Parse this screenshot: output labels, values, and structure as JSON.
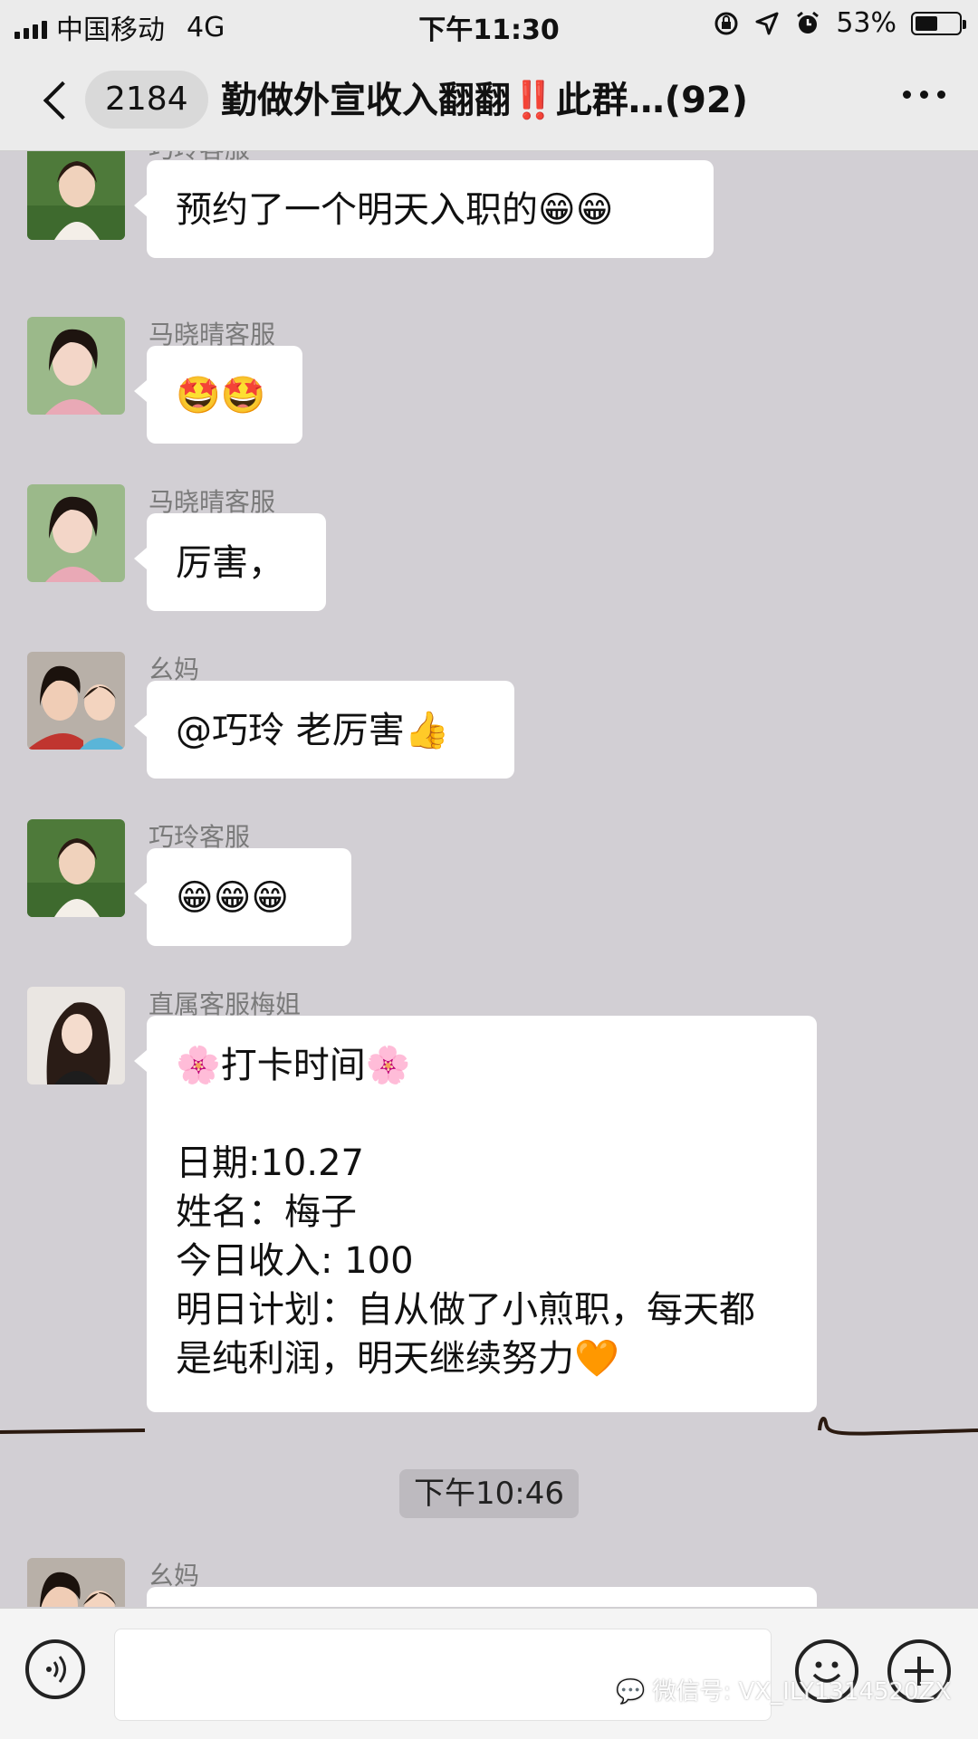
{
  "status_bar": {
    "carrier": "中国移动",
    "network": "4G",
    "time": "下午11:30",
    "battery": "53%",
    "battery_level": 0.53
  },
  "nav": {
    "unread_count": "2184",
    "title": "勤做外宣收入翻翻‼️此群…(92)"
  },
  "messages": [
    {
      "sender": "巧玲客服",
      "text": "预约了一个明天入职的😁😁"
    },
    {
      "sender": "马晓晴客服",
      "text": "🤩🤩"
    },
    {
      "sender": "马晓晴客服",
      "text": "厉害，"
    },
    {
      "sender": "幺妈",
      "text": "@巧玲 老厉害👍"
    },
    {
      "sender": "巧玲客服",
      "text": "😁😁😁"
    },
    {
      "sender": "直属客服梅姐",
      "text": "🌸打卡时间🌸\n\n日期:10.27\n姓名：梅子\n今日收入: 100\n明日计划：自从做了小煎职，每天都是纯利润，明天继续努力🧡"
    },
    {
      "sender": "幺妈",
      "text": ""
    }
  ],
  "time_divider": "下午10:46",
  "watermark": "微信号: VX_ILY1314520ZX",
  "colors": {
    "chat_background": "#d2cfd4",
    "bubble": "#ffffff",
    "bar_background": "#ebebeb"
  }
}
